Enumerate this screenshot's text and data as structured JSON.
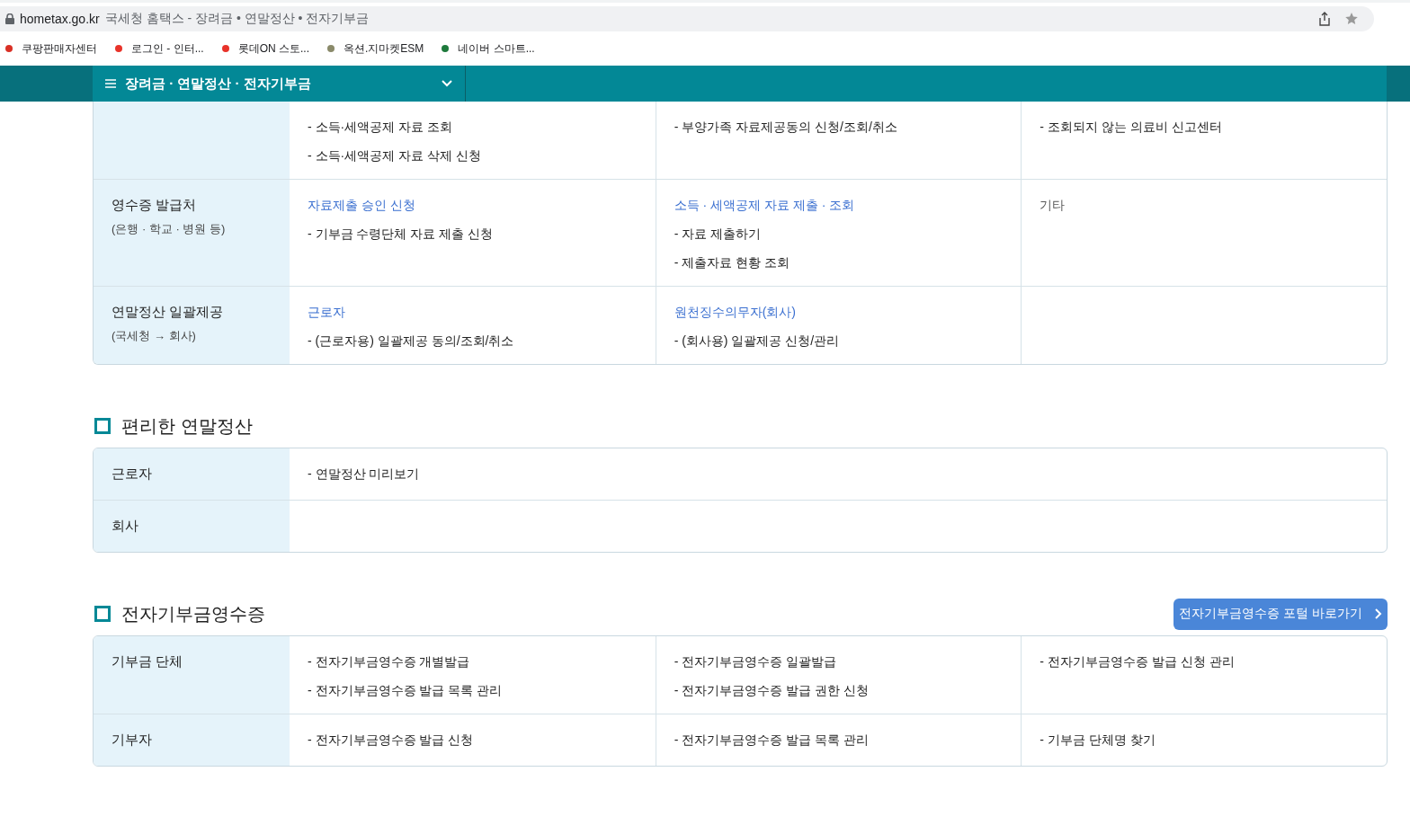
{
  "address_bar": {
    "domain": "hometax.go.kr",
    "title": "국세청 홈택스 - 장려금 • 연말정산 • 전자기부금"
  },
  "bookmarks": [
    {
      "label": "쿠팡판매자센터",
      "color": "#d93025"
    },
    {
      "label": "로그인 - 인터...",
      "color": "#e8332a"
    },
    {
      "label": "롯데ON 스토...",
      "color": "#e8332a"
    },
    {
      "label": "옥션.지마켓ESM",
      "color": "#8a8a6a"
    },
    {
      "label": "네이버 스마트...",
      "color": "#1e7a3c"
    }
  ],
  "nav": {
    "title": "장려금 · 연말정산 · 전자기부금"
  },
  "sections": [
    {
      "rows": [
        {
          "cells": [
            {
              "items": [
                "- 소득·세액공제 자료 조회",
                "- 소득·세액공제 자료 삭제 신청"
              ]
            },
            {
              "items": [
                "- 부양가족 자료제공동의 신청/조회/취소"
              ]
            },
            {
              "items": [
                "- 조회되지 않는 의료비 신고센터"
              ]
            }
          ]
        },
        {
          "label": "영수증 발급처",
          "sublabel": "(은행 · 학교 · 병원 등)",
          "cells": [
            {
              "heading": {
                "text": "자료제출 승인 신청",
                "kind": "link"
              },
              "items": [
                "- 기부금 수령단체 자료 제출 신청"
              ]
            },
            {
              "heading": {
                "text": "소득 · 세액공제 자료 제출 · 조회",
                "kind": "link"
              },
              "items": [
                "- 자료 제출하기",
                "- 제출자료 현황 조회"
              ]
            },
            {
              "heading": {
                "text": "기타",
                "kind": "plain"
              }
            }
          ]
        },
        {
          "label": "연말정산 일괄제공",
          "sublabel": "(국세청 → 회사)",
          "cells": [
            {
              "heading": {
                "text": "근로자",
                "kind": "link"
              },
              "items": [
                "- (근로자용) 일괄제공 동의/조회/취소"
              ]
            },
            {
              "heading": {
                "text": "원천징수의무자(회사)",
                "kind": "link"
              },
              "items": [
                "- (회사용) 일괄제공 신청/관리"
              ]
            },
            {}
          ]
        }
      ]
    },
    {
      "title": "편리한 연말정산",
      "rows": [
        {
          "label": "근로자",
          "cells": [
            {
              "items": [
                "- 연말정산 미리보기"
              ]
            }
          ]
        },
        {
          "label": "회사",
          "cells": [
            {}
          ]
        }
      ]
    },
    {
      "title": "전자기부금영수증",
      "button": "전자기부금영수증 포털 바로가기",
      "rows": [
        {
          "label": "기부금 단체",
          "cells": [
            {
              "items": [
                "- 전자기부금영수증 개별발급",
                "- 전자기부금영수증 발급 목록 관리"
              ]
            },
            {
              "items": [
                "- 전자기부금영수증 일괄발급",
                "- 전자기부금영수증 발급 권한 신청"
              ]
            },
            {
              "items": [
                "- 전자기부금영수증 발급 신청 관리"
              ]
            }
          ]
        },
        {
          "label": "기부자",
          "cells": [
            {
              "items": [
                "- 전자기부금영수증 발급 신청"
              ]
            },
            {
              "items": [
                "- 전자기부금영수증 발급 목록 관리"
              ]
            },
            {
              "items": [
                "- 기부금 단체명 찾기"
              ]
            }
          ]
        }
      ]
    }
  ]
}
